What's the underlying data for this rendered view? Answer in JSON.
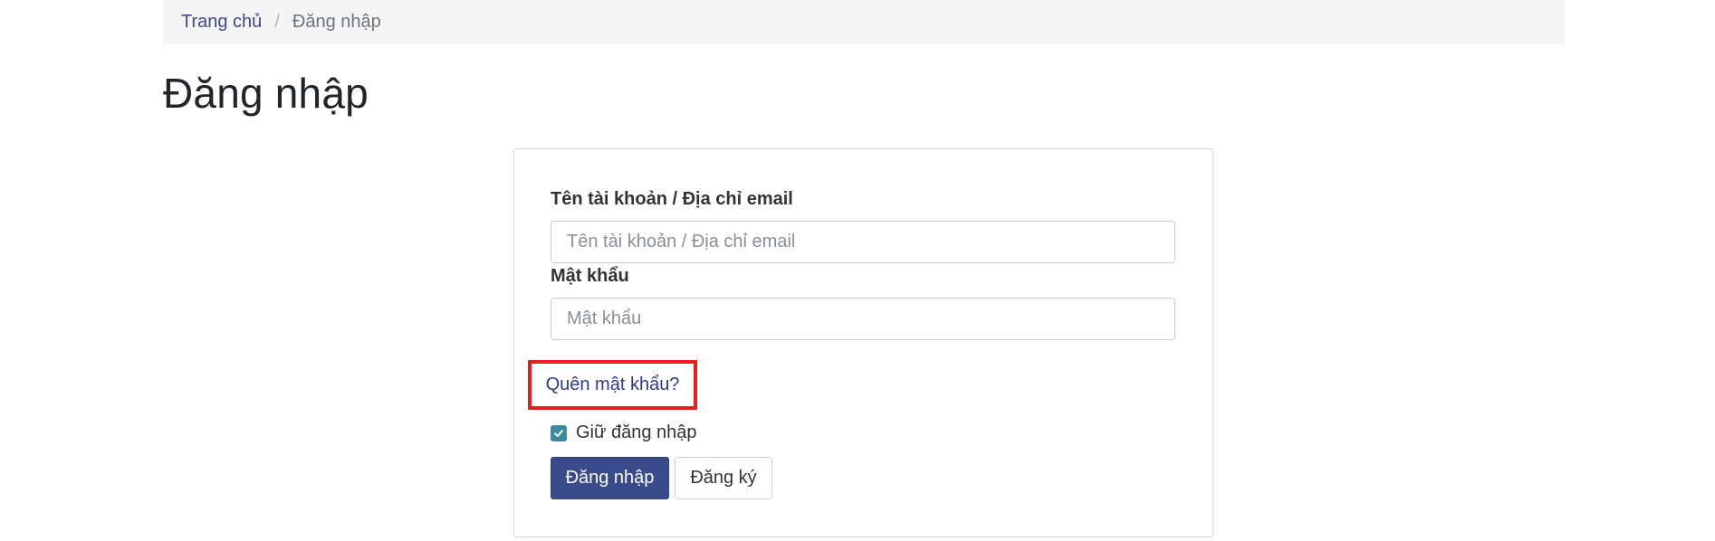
{
  "breadcrumb": {
    "home": "Trang chủ",
    "separator": "/",
    "current": "Đăng nhập"
  },
  "page": {
    "title": "Đăng nhập"
  },
  "form": {
    "username_label": "Tên tài khoản / Địa chỉ email",
    "username_placeholder": "Tên tài khoản / Địa chỉ email",
    "username_value": "",
    "password_label": "Mật khẩu",
    "password_placeholder": "Mật khẩu",
    "password_value": "",
    "forgot_password": "Quên mật khẩu?",
    "remember_label": "Giữ đăng nhập",
    "remember_checked": true,
    "login_button": "Đăng nhập",
    "register_button": "Đăng ký"
  },
  "colors": {
    "primary": "#3a4b8c",
    "link": "#3f4a8a",
    "highlight": "#ea1c1c",
    "checkbox": "#3a8a9e"
  }
}
